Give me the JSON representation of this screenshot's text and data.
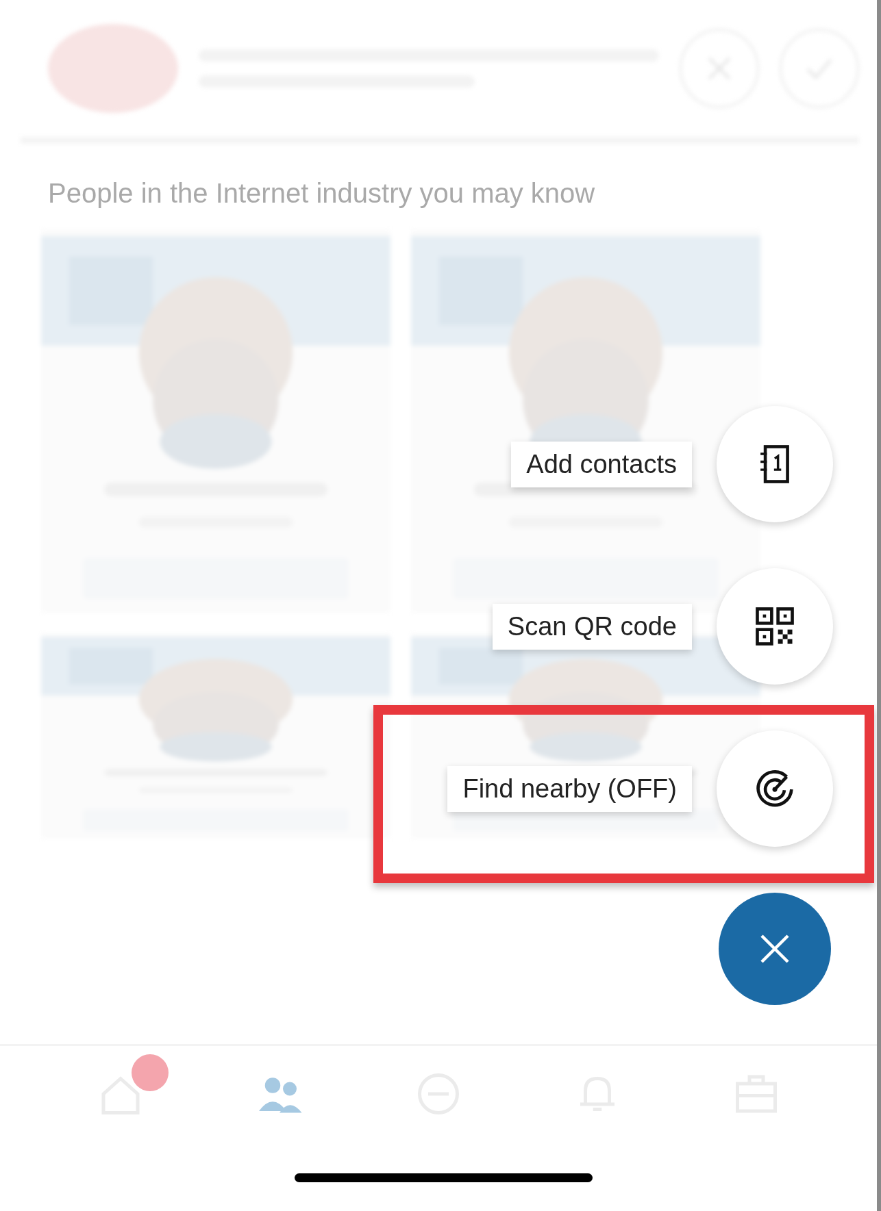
{
  "background": {
    "heading": "People in the Internet industry you may know"
  },
  "speed_dial": [
    {
      "label": "Add contacts",
      "kind": "contacts",
      "highlighted": false
    },
    {
      "label": "Scan QR code",
      "kind": "qr",
      "highlighted": false
    },
    {
      "label": "Find nearby (OFF)",
      "kind": "radar",
      "highlighted": true
    }
  ],
  "bottom_nav": [
    {
      "kind": "home",
      "selected": false,
      "badge": true
    },
    {
      "kind": "people",
      "selected": true,
      "badge": false
    },
    {
      "kind": "post",
      "selected": false,
      "badge": false
    },
    {
      "kind": "bell",
      "selected": false,
      "badge": false
    },
    {
      "kind": "jobs",
      "selected": false,
      "badge": false
    }
  ]
}
